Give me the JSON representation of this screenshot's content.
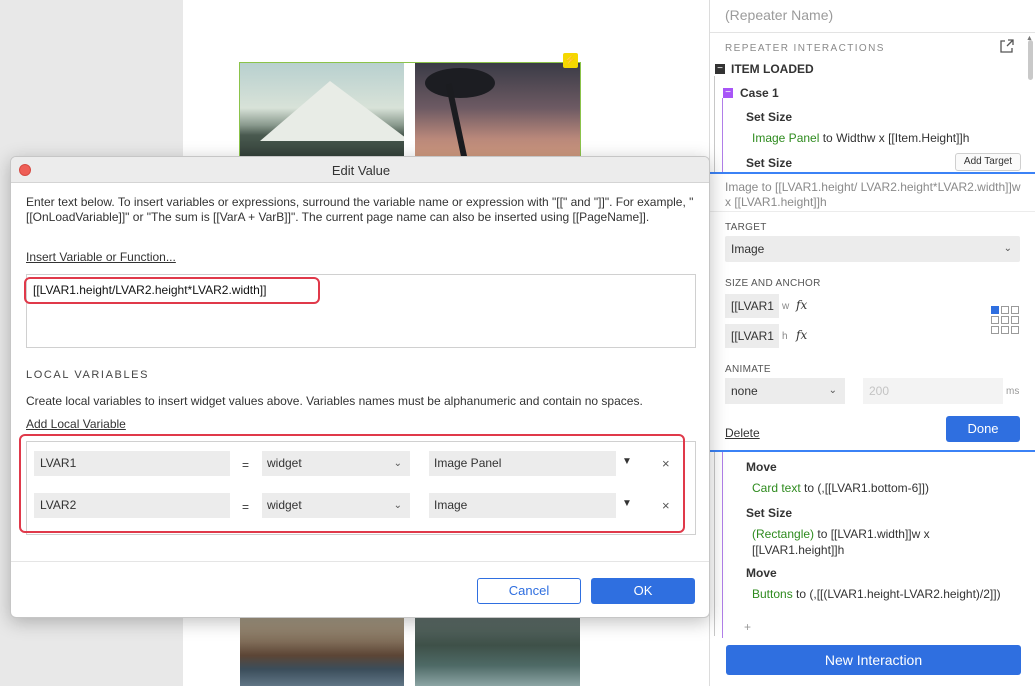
{
  "canvas": {
    "lightning_glyph": "⚡"
  },
  "panel": {
    "title": "(Repeater Name)",
    "section_label": "REPEATER INTERACTIONS",
    "event_label": "ITEM LOADED",
    "case_label": "Case 1",
    "actions": [
      {
        "title": "Set Size",
        "target": "Image Panel",
        "rest": " to Widthw x [[Item.Height]]h"
      },
      {
        "title": "Set Size"
      },
      {
        "title": "Move",
        "target": "Card text",
        "rest": " to (,[[LVAR1.bottom-6]])"
      },
      {
        "title": "Set Size",
        "target": "(Rectangle)",
        "rest": " to [[LVAR1.width]]w x [[LVAR1.height]]h"
      },
      {
        "title": "Move",
        "target": "Buttons",
        "rest": " to (,[[(LVAR1.height-LVAR2.height)/2]])"
      }
    ],
    "add_target_label": "Add Target",
    "edit": {
      "summary": "Image to [[LVAR1.height/ LVAR2.height*LVAR2.width]]w x [[LVAR1.height]]h",
      "target_label": "TARGET",
      "target_value": "Image",
      "size_label": "SIZE AND ANCHOR",
      "width_value": "[[LVAR1",
      "width_unit": "w",
      "height_value": "[[LVAR1",
      "height_unit": "h",
      "fx": "fx",
      "animate_label": "ANIMATE",
      "animate_value": "none",
      "duration_placeholder": "200",
      "ms_label": "ms",
      "delete_label": "Delete",
      "done_label": "Done"
    },
    "add_plus": "+",
    "new_interaction_label": "New Interaction"
  },
  "dialog": {
    "title": "Edit Value",
    "intro": "Enter text below. To insert variables or expressions, surround the variable name or expression with \"[[\" and \"]]\". For example, \"[[OnLoadVariable]]\" or \"The sum is [[VarA + VarB]]\". The current page name can also be inserted using [[PageName]].",
    "insert_link": "Insert Variable or Function...",
    "expression": "[[LVAR1.height/LVAR2.height*LVAR2.width]]",
    "local_vars_label": "LOCAL VARIABLES",
    "local_vars_desc": "Create local variables to insert widget values above. Variables names must be alphanumeric and contain no spaces.",
    "add_local_link": "Add Local Variable",
    "variables": [
      {
        "name": "LVAR1",
        "eq": "=",
        "type": "widget",
        "target": "Image Panel"
      },
      {
        "name": "LVAR2",
        "eq": "=",
        "type": "widget",
        "target": "Image"
      }
    ],
    "cancel_label": "Cancel",
    "ok_label": "OK"
  },
  "colors": {
    "accent": "#2f6fe0",
    "highlight": "#e0394a",
    "case_purple": "#a855f7",
    "target_green": "#2e8b1e"
  }
}
